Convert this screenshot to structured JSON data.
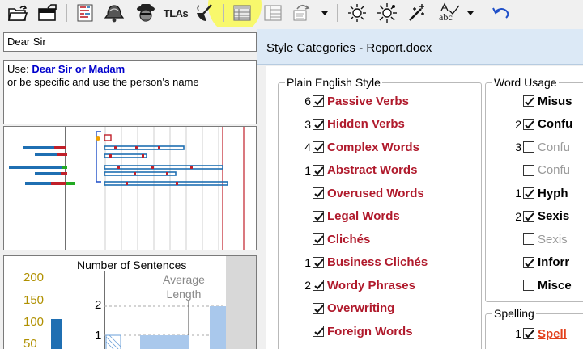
{
  "toolbar": {
    "buttons": [
      {
        "name": "open-folder-icon"
      },
      {
        "name": "save-icon"
      },
      {
        "name": "readability-stats-icon"
      },
      {
        "name": "bell-icon"
      },
      {
        "name": "spy-icon"
      },
      {
        "name": "tlas-button",
        "label": "TLAs"
      },
      {
        "name": "brush-icon"
      },
      {
        "name": "document-view-icon"
      },
      {
        "name": "split-view-icon"
      },
      {
        "name": "route-icon"
      },
      {
        "name": "route-dropdown-icon"
      },
      {
        "name": "sun-icon"
      },
      {
        "name": "sun-burst-icon"
      },
      {
        "name": "sparkle-icon"
      },
      {
        "name": "spelling-abc-icon"
      },
      {
        "name": "spelling-dropdown-icon"
      },
      {
        "name": "undo-icon"
      }
    ]
  },
  "phrase": {
    "value": "Dear Sir"
  },
  "advice": {
    "use_prefix": "Use: ",
    "suggestion": "Dear Sir or Madam",
    "alt_text": "or be specific and use the person's name"
  },
  "histogram": {
    "title": "Number of Sentences",
    "y_labels": [
      "200",
      "150",
      "100",
      "50"
    ],
    "axis_ticks": [
      "2",
      "1"
    ],
    "avg_label_line1": "Average",
    "avg_label_line2": "Length",
    "bar_color": "#1f6fb2",
    "light_bar_color": "#a9c8ec"
  },
  "right": {
    "title": "Style Categories - Report.docx",
    "plain_english": {
      "title": "Plain English Style",
      "items": [
        {
          "count": "6",
          "checked": true,
          "label": "Passive Verbs"
        },
        {
          "count": "3",
          "checked": true,
          "label": "Hidden Verbs"
        },
        {
          "count": "4",
          "checked": true,
          "label": "Complex Words"
        },
        {
          "count": "1",
          "checked": true,
          "label": "Abstract Words"
        },
        {
          "count": "",
          "checked": true,
          "label": "Overused Words"
        },
        {
          "count": "",
          "checked": true,
          "label": "Legal Words"
        },
        {
          "count": "",
          "checked": true,
          "label": "Clichés"
        },
        {
          "count": "1",
          "checked": true,
          "label": "Business Clichés"
        },
        {
          "count": "2",
          "checked": true,
          "label": "Wordy Phrases"
        },
        {
          "count": "",
          "checked": true,
          "label": "Overwriting"
        },
        {
          "count": "",
          "checked": true,
          "label": "Foreign Words"
        }
      ]
    },
    "word_usage": {
      "title": "Word Usage",
      "items": [
        {
          "count": "",
          "checked": true,
          "label": "Misus",
          "style": "black"
        },
        {
          "count": "2",
          "checked": true,
          "label": "Confu",
          "style": "black"
        },
        {
          "count": "3",
          "checked": false,
          "label": "Confu",
          "style": "gray"
        },
        {
          "count": "",
          "checked": false,
          "label": "Confu",
          "style": "gray"
        },
        {
          "count": "1",
          "checked": true,
          "label": "Hyph",
          "style": "black"
        },
        {
          "count": "2",
          "checked": true,
          "label": "Sexis",
          "style": "black"
        },
        {
          "count": "",
          "checked": false,
          "label": "Sexis",
          "style": "gray"
        },
        {
          "count": "",
          "checked": true,
          "label": "Inforr",
          "style": "black"
        },
        {
          "count": "",
          "checked": false,
          "label": "Misce",
          "style": "black"
        }
      ]
    },
    "spelling": {
      "title": "Spelling",
      "items": [
        {
          "count": "1",
          "checked": true,
          "label": "Spell",
          "style": "orange"
        }
      ]
    }
  },
  "colors": {
    "category_red": "#b01a2c",
    "header_blue": "#dce9f6",
    "highlight_yellow": "#ffff00"
  }
}
